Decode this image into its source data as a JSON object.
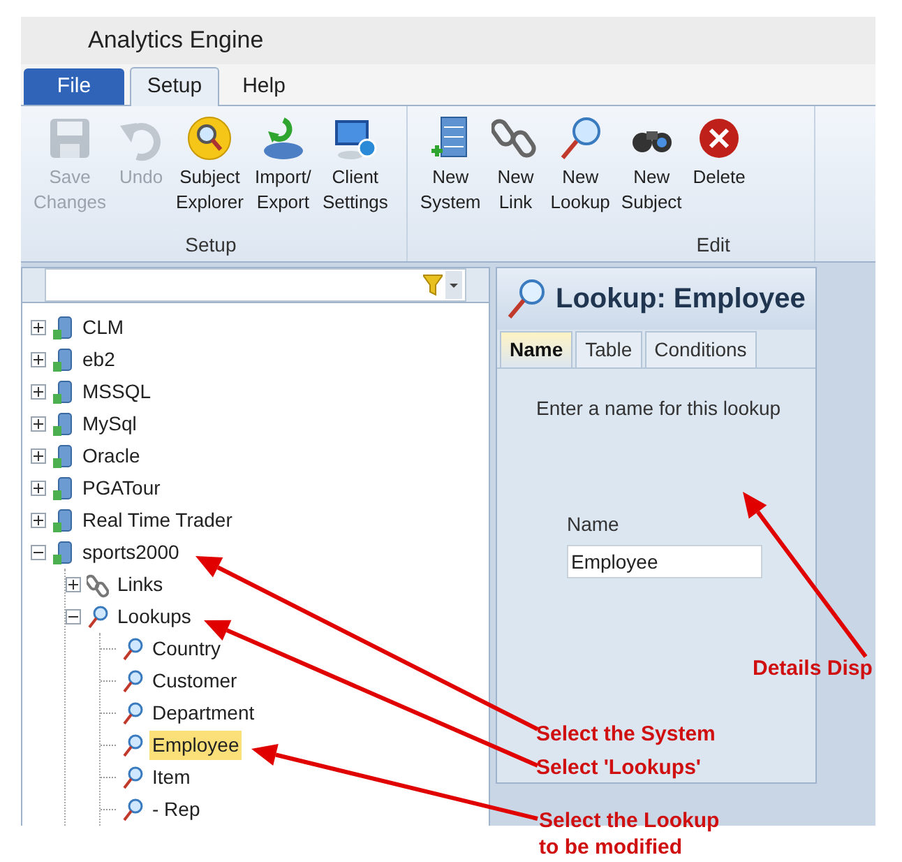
{
  "window": {
    "title": "Analytics Engine"
  },
  "menu_tabs": [
    {
      "label": "File",
      "kind": "file",
      "selected": false
    },
    {
      "label": "Setup",
      "kind": "tab",
      "selected": true
    },
    {
      "label": "Help",
      "kind": "tab",
      "selected": false
    }
  ],
  "ribbon_groups": [
    {
      "label": "Setup",
      "buttons": [
        {
          "kind": "save",
          "lines": [
            "Save",
            "Changes"
          ],
          "disabled": true
        },
        {
          "kind": "undo",
          "lines": [
            "Undo"
          ],
          "disabled": true
        },
        {
          "kind": "subject_explorer",
          "lines": [
            "Subject",
            "Explorer"
          ],
          "disabled": false
        },
        {
          "kind": "import_export",
          "lines": [
            "Import/",
            "Export"
          ],
          "disabled": false
        },
        {
          "kind": "client_settings",
          "lines": [
            "Client",
            "Settings"
          ],
          "disabled": false
        }
      ]
    },
    {
      "label": "Edit",
      "buttons": [
        {
          "kind": "new_system",
          "lines": [
            "New",
            "System"
          ],
          "disabled": false
        },
        {
          "kind": "new_link",
          "lines": [
            "New",
            "Link"
          ],
          "disabled": false
        },
        {
          "kind": "new_lookup",
          "lines": [
            "New",
            "Lookup"
          ],
          "disabled": false
        },
        {
          "kind": "new_subject",
          "lines": [
            "New",
            "Subject"
          ],
          "disabled": false
        },
        {
          "kind": "delete",
          "lines": [
            "Delete"
          ],
          "disabled": false
        }
      ]
    }
  ],
  "tree": [
    {
      "label": "CLM",
      "kind": "system",
      "expanded": false,
      "selected": false
    },
    {
      "label": "eb2",
      "kind": "system",
      "expanded": false,
      "selected": false
    },
    {
      "label": "MSSQL",
      "kind": "system",
      "expanded": false,
      "selected": false
    },
    {
      "label": "MySql",
      "kind": "system",
      "expanded": false,
      "selected": false
    },
    {
      "label": "Oracle",
      "kind": "system",
      "expanded": false,
      "selected": false
    },
    {
      "label": "PGATour",
      "kind": "system",
      "expanded": false,
      "selected": false
    },
    {
      "label": "Real Time Trader",
      "kind": "system",
      "expanded": false,
      "selected": false
    },
    {
      "label": "sports2000",
      "kind": "system",
      "expanded": true,
      "selected": false,
      "children": [
        {
          "label": "Links",
          "kind": "links",
          "expanded": false,
          "selected": false
        },
        {
          "label": "Lookups",
          "kind": "lookup",
          "expanded": true,
          "selected": false,
          "children": [
            {
              "label": "Country",
              "kind": "lookup",
              "selected": false
            },
            {
              "label": "Customer",
              "kind": "lookup",
              "selected": false
            },
            {
              "label": "Department",
              "kind": "lookup",
              "selected": false
            },
            {
              "label": "Employee",
              "kind": "lookup",
              "selected": true
            },
            {
              "label": "Item",
              "kind": "lookup",
              "selected": false
            },
            {
              "label": "- Rep",
              "kind": "lookup",
              "selected": false
            }
          ]
        }
      ]
    }
  ],
  "detail": {
    "title": "Lookup: Employee",
    "tabs": [
      {
        "label": "Name",
        "selected": true
      },
      {
        "label": "Table",
        "selected": false
      },
      {
        "label": "Conditions",
        "selected": false
      }
    ],
    "instruction": "Enter a name for this lookup",
    "field": {
      "label": "Name",
      "value": "Employee"
    }
  },
  "annotations": [
    {
      "text": "Details Disp"
    },
    {
      "text": "Select the System"
    },
    {
      "text": "Select 'Lookups'"
    },
    {
      "text": "Select the Lookup to be modified"
    }
  ]
}
